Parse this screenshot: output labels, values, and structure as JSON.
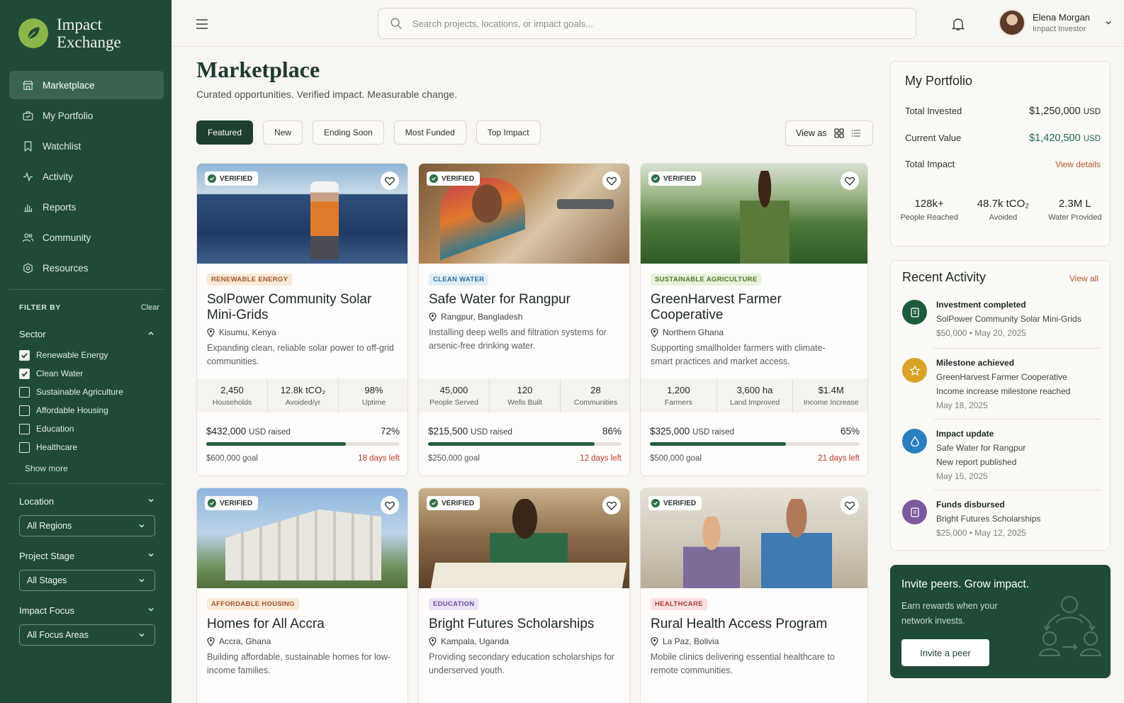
{
  "brand": {
    "line1": "Impact",
    "line2": "Exchange"
  },
  "nav": [
    {
      "label": "Marketplace",
      "icon": "store-icon",
      "active": true
    },
    {
      "label": "My Portfolio",
      "icon": "briefcase-icon"
    },
    {
      "label": "Watchlist",
      "icon": "bookmark-icon"
    },
    {
      "label": "Activity",
      "icon": "activity-icon"
    },
    {
      "label": "Reports",
      "icon": "bar-chart-icon"
    },
    {
      "label": "Community",
      "icon": "users-icon"
    },
    {
      "label": "Resources",
      "icon": "resources-icon"
    }
  ],
  "filters": {
    "title": "FILTER BY",
    "clear": "Clear",
    "sector_label": "Sector",
    "sectors": [
      {
        "label": "Renewable Energy",
        "checked": true
      },
      {
        "label": "Clean Water",
        "checked": true
      },
      {
        "label": "Sustainable Agriculture",
        "checked": false
      },
      {
        "label": "Affordable Housing",
        "checked": false
      },
      {
        "label": "Education",
        "checked": false
      },
      {
        "label": "Healthcare",
        "checked": false
      }
    ],
    "show_more": "Show more",
    "location_label": "Location",
    "location_value": "All Regions",
    "stage_label": "Project Stage",
    "stage_value": "All Stages",
    "focus_label": "Impact Focus",
    "focus_value": "All Focus Areas"
  },
  "search": {
    "placeholder": "Search projects, locations, or impact goals..."
  },
  "user": {
    "name": "Elena Morgan",
    "role": "Impact Investor"
  },
  "page": {
    "title": "Marketplace",
    "subtitle": "Curated opportunities. Verified impact. Measurable change."
  },
  "tabs": [
    "Featured",
    "New",
    "Ending Soon",
    "Most Funded",
    "Top Impact"
  ],
  "view_as": "View as",
  "verified_label": "VERIFIED",
  "projects": [
    {
      "category": "RENEWABLE ENERGY",
      "cat_color": "#a0582a",
      "cat_bg": "#fbe9d9",
      "title": "SolPower Community Solar Mini-Grids",
      "location": "Kisumu, Kenya",
      "description": "Expanding clean, reliable solar power to off-grid communities.",
      "stats": [
        {
          "v": "2,450",
          "l": "Households"
        },
        {
          "v": "12.8k tCO₂",
          "l": "Avoided/yr"
        },
        {
          "v": "98%",
          "l": "Uptime"
        }
      ],
      "raised": "$432,000",
      "usd": "USD raised",
      "pct_label": "72%",
      "pct": 72,
      "goal": "$600,000 goal",
      "days": "18 days left"
    },
    {
      "category": "CLEAN WATER",
      "cat_color": "#2a6e9e",
      "cat_bg": "#e0eef8",
      "title": "Safe Water for Rangpur",
      "location": "Rangpur, Bangladesh",
      "description": "Installing deep wells and filtration systems for arsenic-free drinking water.",
      "stats": [
        {
          "v": "45,000",
          "l": "People Served"
        },
        {
          "v": "120",
          "l": "Wells Built"
        },
        {
          "v": "28",
          "l": "Communities"
        }
      ],
      "raised": "$215,500",
      "usd": "USD raised",
      "pct_label": "86%",
      "pct": 86,
      "goal": "$250,000 goal",
      "days": "12 days left"
    },
    {
      "category": "SUSTAINABLE AGRICULTURE",
      "cat_color": "#4d7a2a",
      "cat_bg": "#e8f1dc",
      "title": "GreenHarvest Farmer Cooperative",
      "location": "Northern Ghana",
      "description": "Supporting smallholder farmers with climate-smart practices and market access.",
      "stats": [
        {
          "v": "1,200",
          "l": "Farmers"
        },
        {
          "v": "3,600 ha",
          "l": "Land Improved"
        },
        {
          "v": "$1.4M",
          "l": "Income Increase"
        }
      ],
      "raised": "$325,000",
      "usd": "USD raised",
      "pct_label": "65%",
      "pct": 65,
      "goal": "$500,000 goal",
      "days": "21 days left"
    },
    {
      "category": "AFFORDABLE HOUSING",
      "cat_color": "#a0582a",
      "cat_bg": "#fbe9d9",
      "title": "Homes for All Accra",
      "location": "Accra, Ghana",
      "description": "Building affordable, sustainable homes for low-income families."
    },
    {
      "category": "EDUCATION",
      "cat_color": "#6b4a9e",
      "cat_bg": "#ece4f6",
      "title": "Bright Futures Scholarships",
      "location": "Kampala, Uganda",
      "description": "Providing secondary education scholarships for underserved youth."
    },
    {
      "category": "HEALTHCARE",
      "cat_color": "#b33a3a",
      "cat_bg": "#f9e1e1",
      "title": "Rural Health Access Program",
      "location": "La Paz, Bolivia",
      "description": "Mobile clinics delivering essential healthcare to remote communities."
    }
  ],
  "portfolio": {
    "title": "My Portfolio",
    "invested_label": "Total Invested",
    "invested_value": "$1,250,000",
    "invested_unit": "USD",
    "current_label": "Current Value",
    "current_value": "$1,420,500",
    "current_unit": "USD",
    "impact_label": "Total Impact",
    "impact_link": "View details",
    "impact_stats": [
      {
        "v": "128k+",
        "l": "People Reached"
      },
      {
        "v": "48.7k tCO₂",
        "l": "Avoided"
      },
      {
        "v": "2.3M L",
        "l": "Water Provided"
      }
    ]
  },
  "activity": {
    "title": "Recent Activity",
    "link": "View all",
    "items": [
      {
        "title": "Investment completed",
        "lines": [
          "SolPower Community Solar Mini-Grids"
        ],
        "date": "$50,000  •  May 20, 2025",
        "color": "#1f5c3d",
        "icon": "document-icon"
      },
      {
        "title": "Milestone achieved",
        "lines": [
          "GreenHarvest Farmer Cooperative",
          "Income increase milestone reached"
        ],
        "date": "May 18, 2025",
        "color": "#d9a227",
        "icon": "star-icon"
      },
      {
        "title": "Impact update",
        "lines": [
          "Safe Water for Rangpur",
          "New report published"
        ],
        "date": "May 15, 2025",
        "color": "#2a7fc1",
        "icon": "droplet-icon"
      },
      {
        "title": "Funds disbursed",
        "lines": [
          "Bright Futures Scholarships"
        ],
        "date": "$25,000  •  May 12, 2025",
        "color": "#7b5a9e",
        "icon": "document-icon"
      }
    ]
  },
  "invite": {
    "title": "Invite peers. Grow impact.",
    "text": "Earn rewards when your network invests.",
    "button": "Invite a peer"
  }
}
